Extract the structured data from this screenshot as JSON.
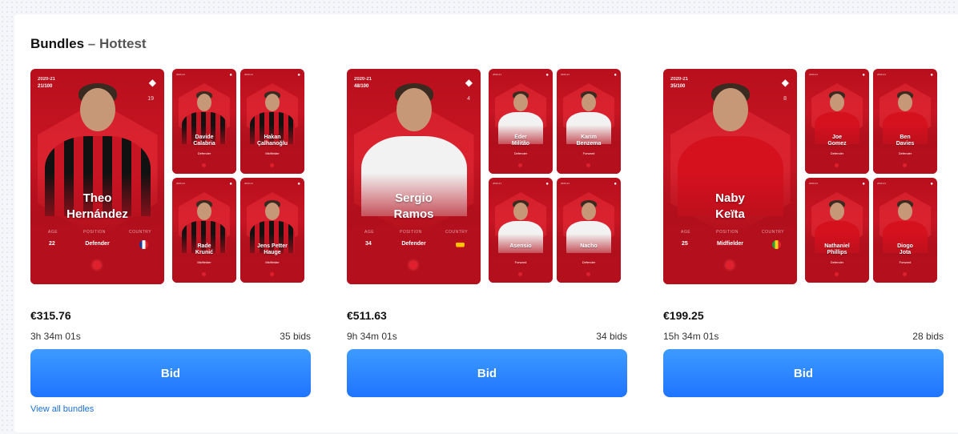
{
  "section": {
    "title": "Bundles",
    "separator": "–",
    "subtitle": "Hottest"
  },
  "bundles": [
    {
      "main": {
        "season": "2020-21",
        "serial": "21/100",
        "number": "19",
        "name1": "Theo",
        "name2": "Hernández",
        "age_label": "AGE",
        "age": "22",
        "position_label": "POSITION",
        "position": "Defender",
        "country_label": "COUNTRY",
        "crest": "milan-crest",
        "color": "#c81524"
      },
      "minis": [
        {
          "name1": "Davide",
          "name2": "Calabria",
          "meta": "2020-21",
          "pos": "Defender"
        },
        {
          "name1": "Hakan",
          "name2": "Çalhanoğlu",
          "meta": "2020-21",
          "pos": "Midfielder"
        },
        {
          "name1": "Rade",
          "name2": "Krunić",
          "meta": "2020-21",
          "pos": "Midfielder"
        },
        {
          "name1": "Jens Petter",
          "name2": "Hauge",
          "meta": "2020-21",
          "pos": "Midfielder"
        }
      ],
      "price": "€315.76",
      "timer": "3h 34m 01s",
      "bids": "35 bids",
      "button": "Bid"
    },
    {
      "main": {
        "season": "2020-21",
        "serial": "48/100",
        "number": "4",
        "name1": "Sergio",
        "name2": "Ramos",
        "age_label": "AGE",
        "age": "34",
        "position_label": "POSITION",
        "position": "Defender",
        "country_label": "COUNTRY",
        "crest": "real-madrid-crest",
        "color": "#c81524"
      },
      "minis": [
        {
          "name1": "Éder",
          "name2": "Militão",
          "meta": "2020-21",
          "pos": "Defender"
        },
        {
          "name1": "Karim",
          "name2": "Benzema",
          "meta": "2020-21",
          "pos": "Forward"
        },
        {
          "name1": "",
          "name2": "Asensio",
          "meta": "2020-21",
          "pos": "Forward"
        },
        {
          "name1": "",
          "name2": "Nacho",
          "meta": "2020-21",
          "pos": "Defender"
        }
      ],
      "price": "€511.63",
      "timer": "9h 34m 01s",
      "bids": "34 bids",
      "button": "Bid"
    },
    {
      "main": {
        "season": "2020-21",
        "serial": "35/100",
        "number": "8",
        "name1": "Naby",
        "name2": "Keïta",
        "age_label": "AGE",
        "age": "25",
        "position_label": "POSITION",
        "position": "Midfielder",
        "country_label": "COUNTRY",
        "crest": "liverpool-crest",
        "color": "#c81524"
      },
      "minis": [
        {
          "name1": "Joe",
          "name2": "Gomez",
          "meta": "2020-21",
          "pos": "Defender"
        },
        {
          "name1": "Ben",
          "name2": "Davies",
          "meta": "2020-21",
          "pos": "Defender"
        },
        {
          "name1": "Nathaniel",
          "name2": "Phillips",
          "meta": "2020-21",
          "pos": "Defender"
        },
        {
          "name1": "Diogo",
          "name2": "Jota",
          "meta": "2020-21",
          "pos": "Forward"
        }
      ],
      "price": "€199.25",
      "timer": "15h 34m 01s",
      "bids": "28 bids",
      "button": "Bid"
    }
  ],
  "view_all": "View all bundles",
  "colors": {
    "accent": "#1f74ff",
    "card_red": "#c81524",
    "link": "#1a6fd6"
  }
}
